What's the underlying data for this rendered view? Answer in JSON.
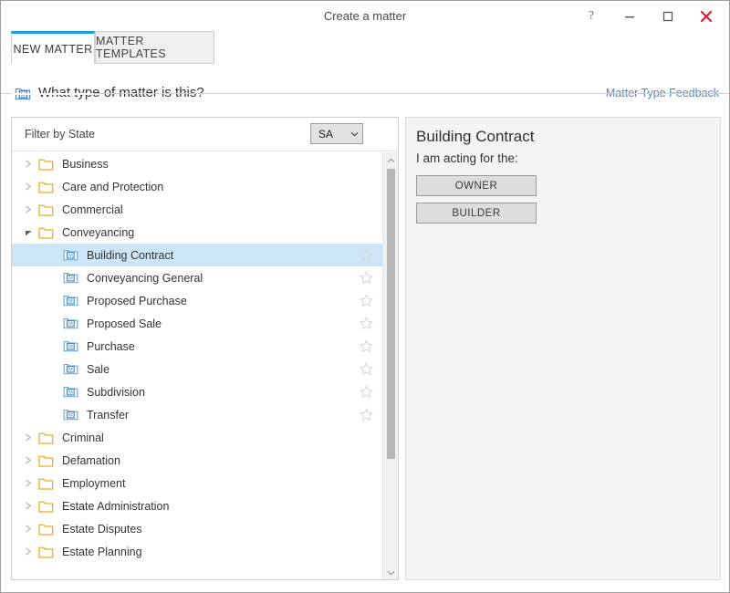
{
  "window": {
    "title": "Create a matter",
    "controls": [
      {
        "name": "help-button",
        "glyph": "?"
      },
      {
        "name": "minimize-button",
        "glyph": "–"
      },
      {
        "name": "maximize-button",
        "glyph": "□"
      },
      {
        "name": "close-button",
        "glyph": "×"
      }
    ],
    "close_color": "#e01b24",
    "accent_color": "#1c9fe0"
  },
  "tabs": [
    {
      "label": "NEW MATTER",
      "active": true
    },
    {
      "label": "MATTER TEMPLATES",
      "active": false
    }
  ],
  "header": {
    "icon": "matter-folder-icon",
    "question": "What type of matter is this?",
    "feedback_link": "Matter Type Feedback",
    "link_color": "#4a86c8"
  },
  "filter": {
    "label": "Filter by State",
    "state_value": "SA",
    "state_options": [
      "SA"
    ],
    "chevron": "chevron-down-icon"
  },
  "tree": {
    "selected": "Building Contract",
    "folder_color": "#f5a623",
    "selection_color": "#cde6f7",
    "items": [
      {
        "label": "Business",
        "type": "folder",
        "expanded": false,
        "level": 0,
        "star": false
      },
      {
        "label": "Care and Protection",
        "type": "folder",
        "expanded": false,
        "level": 0,
        "star": false
      },
      {
        "label": "Commercial",
        "type": "folder",
        "expanded": false,
        "level": 0,
        "star": false
      },
      {
        "label": "Conveyancing",
        "type": "folder",
        "expanded": true,
        "level": 0,
        "star": false
      },
      {
        "label": "Building Contract",
        "type": "matter",
        "level": 1,
        "star": true,
        "selected": true
      },
      {
        "label": "Conveyancing General",
        "type": "matter",
        "level": 1,
        "star": true
      },
      {
        "label": "Proposed Purchase",
        "type": "matter",
        "level": 1,
        "star": true
      },
      {
        "label": "Proposed Sale",
        "type": "matter",
        "level": 1,
        "star": true
      },
      {
        "label": "Purchase",
        "type": "matter",
        "level": 1,
        "star": true
      },
      {
        "label": "Sale",
        "type": "matter",
        "level": 1,
        "star": true
      },
      {
        "label": "Subdivision",
        "type": "matter",
        "level": 1,
        "star": true
      },
      {
        "label": "Transfer",
        "type": "matter",
        "level": 1,
        "star": true
      },
      {
        "label": "Criminal",
        "type": "folder",
        "expanded": false,
        "level": 0,
        "star": false
      },
      {
        "label": "Defamation",
        "type": "folder",
        "expanded": false,
        "level": 0,
        "star": false
      },
      {
        "label": "Employment",
        "type": "folder",
        "expanded": false,
        "level": 0,
        "star": false
      },
      {
        "label": "Estate Administration",
        "type": "folder",
        "expanded": false,
        "level": 0,
        "star": false
      },
      {
        "label": "Estate Disputes",
        "type": "folder",
        "expanded": false,
        "level": 0,
        "star": false
      },
      {
        "label": "Estate Planning",
        "type": "folder",
        "expanded": false,
        "level": 0,
        "star": false
      }
    ]
  },
  "scrollbar": {
    "up_arrow": "chevron-up-icon",
    "down_arrow": "chevron-down-icon"
  },
  "detail": {
    "title": "Building Contract",
    "subtitle": "I am acting for the:",
    "roles": [
      {
        "label": "OWNER"
      },
      {
        "label": "BUILDER"
      }
    ]
  }
}
